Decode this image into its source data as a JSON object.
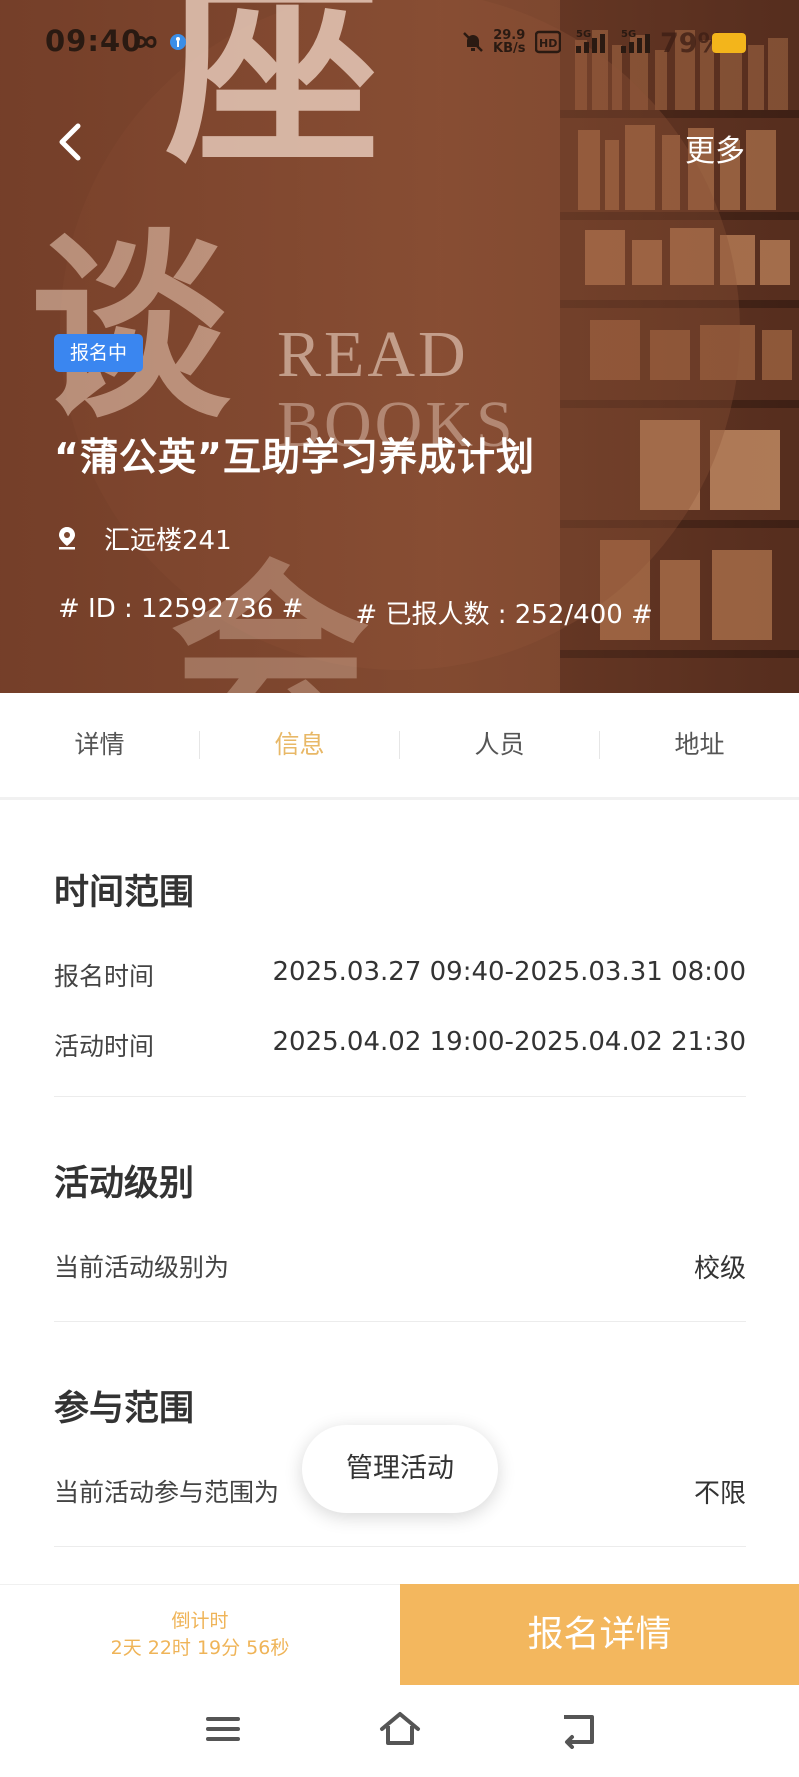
{
  "status_bar": {
    "time": "09:40",
    "network_speed_value": "29.9",
    "network_speed_unit": "KB/s",
    "battery": "79%",
    "icons": [
      "infinity-icon",
      "accessibility-icon",
      "mute-bell-icon",
      "hd-icon",
      "signal-5g-icon",
      "signal-5g-icon-2",
      "battery-icon"
    ],
    "battery_color": "#f3b51b"
  },
  "header": {
    "back_icon": "chevron-left-icon",
    "more_label": "更多"
  },
  "hero": {
    "cover_chars": [
      "座",
      "谈",
      "会"
    ],
    "cover_en_line1": "READ",
    "cover_en_line2": "BOOKS",
    "status_tag": "报名中",
    "status_tag_color": "#3a86f0",
    "title": "“蒲公英”互助学习养成计划",
    "location": "汇远楼241",
    "id_text": "# ID : 12592736 #",
    "registered_text": "# 已报人数 : 252/400 #"
  },
  "tabs": [
    {
      "label": "详情",
      "active": false
    },
    {
      "label": "信息",
      "active": true
    },
    {
      "label": "人员",
      "active": false
    },
    {
      "label": "地址",
      "active": false
    }
  ],
  "accent_color": "#e8b867",
  "sections": {
    "time_range": {
      "title": "时间范围",
      "rows": [
        {
          "label": "报名时间",
          "value": "2025.03.27 09:40-2025.03.31 08:00"
        },
        {
          "label": "活动时间",
          "value": "2025.04.02 19:00-2025.04.02 21:30"
        }
      ]
    },
    "level": {
      "title": "活动级别",
      "label": "当前活动级别为",
      "value": "校级"
    },
    "scope": {
      "title": "参与范围",
      "label": "当前活动参与范围为",
      "value": "不限"
    }
  },
  "fab_label": "管理活动",
  "bottom_bar": {
    "countdown_label": "倒计时",
    "countdown_value": "2天 22时 19分 56秒",
    "action_label": "报名详情",
    "action_color": "#f3b75e"
  },
  "system_nav": {
    "icons": [
      "menu-icon",
      "home-icon",
      "back-icon"
    ]
  }
}
